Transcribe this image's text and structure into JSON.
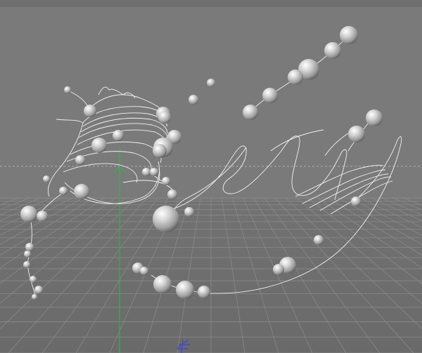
{
  "viewport": {
    "background_color": "#7a7a7a",
    "floor_color": "#6e6e6e",
    "grid_color": "#8c8c8c",
    "horizon_line_color": "#a6b3c4",
    "axis_y_color": "#37b04a",
    "axis_z_color": "#3b47d6",
    "spline_color": "#f2f2f2",
    "sphere_highlight": "#ffffff",
    "sphere_base": "#bdbdbd",
    "sphere_shadow": "#4a4a4a"
  },
  "objects": {
    "spline_name": "cloud-spline",
    "sphere_material": "grey-spheres",
    "gizmo": "y-axis-gizmo"
  }
}
